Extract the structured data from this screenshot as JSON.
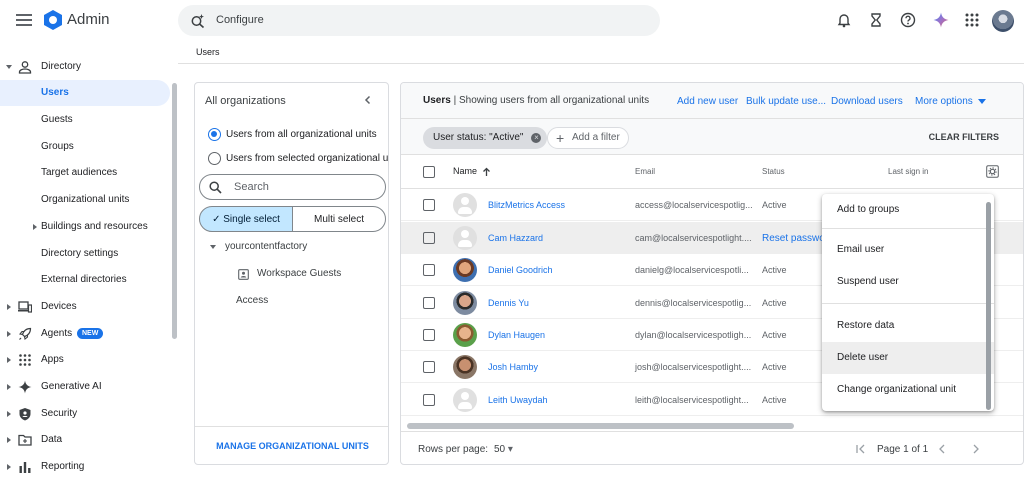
{
  "app": {
    "title": "Admin"
  },
  "search": {
    "text": "Configure"
  },
  "breadcrumb": {
    "label": "Users"
  },
  "sidebar": {
    "items": [
      {
        "label": "Directory",
        "icon": "person-icon",
        "expanded": true
      },
      {
        "label": "Users",
        "active": true
      },
      {
        "label": "Guests"
      },
      {
        "label": "Groups"
      },
      {
        "label": "Target audiences"
      },
      {
        "label": "Organizational units"
      },
      {
        "label": "Buildings and resources"
      },
      {
        "label": "Directory settings"
      },
      {
        "label": "External directories"
      },
      {
        "label": "Devices",
        "icon": "devices-icon"
      },
      {
        "label": "Agents",
        "icon": "rocket-icon",
        "badge": "NEW"
      },
      {
        "label": "Apps",
        "icon": "apps-grid-icon"
      },
      {
        "label": "Generative AI",
        "icon": "sparkle-icon"
      },
      {
        "label": "Security",
        "icon": "shield-icon"
      },
      {
        "label": "Data",
        "icon": "folder-icon"
      },
      {
        "label": "Reporting",
        "icon": "bar-chart-icon"
      }
    ]
  },
  "org_panel": {
    "title": "All organizations",
    "radio_all": "Users from all organizational units",
    "radio_selected": "Users from selected organizational units",
    "search_placeholder": "Search",
    "single_select": "Single select",
    "multi_select": "Multi select",
    "tree_root": "yourcontentfactory",
    "tree_child": "Workspace Guests",
    "tree_access": "Access",
    "manage_link": "MANAGE ORGANIZATIONAL UNITS"
  },
  "users_panel": {
    "title_bold": "Users",
    "title_rest": " | Showing users from all organizational units",
    "add_new_user": "Add new user",
    "bulk_update": "Bulk update use...",
    "download_users": "Download users",
    "more_options": "More options",
    "filter_chip": "User status: \"Active\"",
    "add_filter": "Add a filter",
    "clear_filters": "CLEAR FILTERS",
    "columns": {
      "name": "Name",
      "email": "Email",
      "status": "Status",
      "last_sign_in": "Last sign in"
    },
    "rows": [
      {
        "name": "BlitzMetrics Access",
        "email": "access@localservicespotlig...",
        "status": "Active",
        "avatar": "default"
      },
      {
        "name": "Cam Hazzard",
        "email": "cam@localservicespotlight....",
        "status": "Reset password",
        "avatar": "default"
      },
      {
        "name": "Daniel Goodrich",
        "email": "danielg@localservicespotli...",
        "status": "Active",
        "avatar": "photo"
      },
      {
        "name": "Dennis Yu",
        "email": "dennis@localservicespotlig...",
        "status": "Active",
        "avatar": "photo"
      },
      {
        "name": "Dylan Haugen",
        "email": "dylan@localservicespotligh...",
        "status": "Active",
        "avatar": "photo"
      },
      {
        "name": "Josh Hamby",
        "email": "josh@localservicespotlight....",
        "status": "Active",
        "avatar": "photo"
      },
      {
        "name": "Leith Uwaydah",
        "email": "leith@localservicespotlight...",
        "status": "Active",
        "avatar": "default"
      }
    ],
    "rows_per_page_label": "Rows per page:",
    "rows_per_page_value": "50",
    "page_label": "Page 1 of 1"
  },
  "context_menu": {
    "items": [
      "Add to groups",
      "Email user",
      "Suspend user",
      "Restore data",
      "Delete user",
      "Change organizational unit"
    ]
  },
  "colors": {
    "accent": "#1a73e8",
    "selected_bg": "#e8f0fe",
    "segment_selected": "#c2e7ff"
  }
}
